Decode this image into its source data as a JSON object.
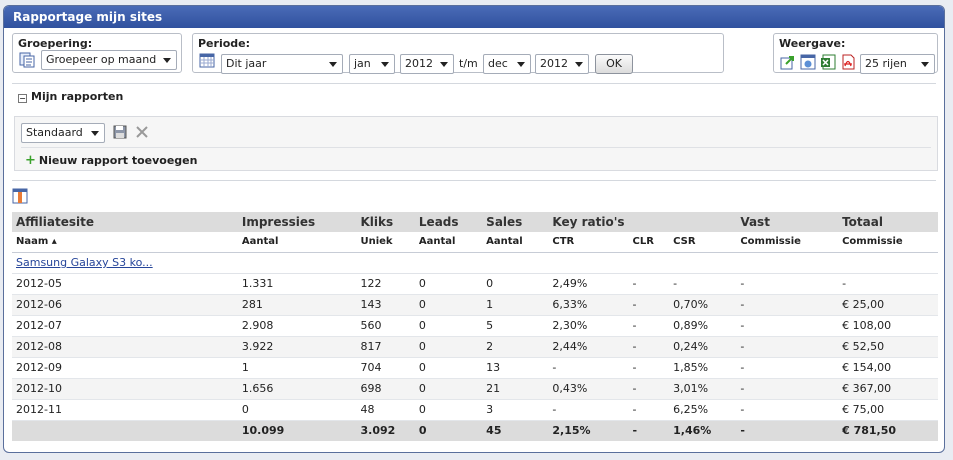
{
  "header": {
    "title": "Rapportage mijn sites"
  },
  "grouping": {
    "label": "Groepering:",
    "value": "Groepeer op maand"
  },
  "period": {
    "label": "Periode:",
    "range": "Dit jaar",
    "from_month": "jan",
    "from_year": "2012",
    "separator": "t/m",
    "to_month": "dec",
    "to_year": "2012",
    "ok_label": "OK"
  },
  "view": {
    "label": "Weergave:",
    "rows": "25 rijen"
  },
  "reports": {
    "toggle": "⊟",
    "title": "Mijn rapporten",
    "selected": "Standaard",
    "add_label": "Nieuw rapport toevoegen"
  },
  "table": {
    "groups": [
      "Affiliatesite",
      "Impressies",
      "Kliks",
      "Leads",
      "Sales",
      "Key ratio's",
      "",
      "",
      "Vast",
      "Totaal"
    ],
    "subheaders": [
      "Naam ▴",
      "Aantal",
      "Uniek",
      "Aantal",
      "Aantal",
      "CTR",
      "CLR",
      "CSR",
      "Commissie",
      "Commissie"
    ],
    "site_link": "Samsung Galaxy S3 ko...",
    "rows": [
      [
        "2012-05",
        "1.331",
        "122",
        "0",
        "0",
        "2,49%",
        "-",
        "-",
        "-",
        "-"
      ],
      [
        "2012-06",
        "281",
        "143",
        "0",
        "1",
        "6,33%",
        "-",
        "0,70%",
        "-",
        "€ 25,00"
      ],
      [
        "2012-07",
        "2.908",
        "560",
        "0",
        "5",
        "2,30%",
        "-",
        "0,89%",
        "-",
        "€ 108,00"
      ],
      [
        "2012-08",
        "3.922",
        "817",
        "0",
        "2",
        "2,44%",
        "-",
        "0,24%",
        "-",
        "€ 52,50"
      ],
      [
        "2012-09",
        "1",
        "704",
        "0",
        "13",
        "-",
        "-",
        "1,85%",
        "-",
        "€ 154,00"
      ],
      [
        "2012-10",
        "1.656",
        "698",
        "0",
        "21",
        "0,43%",
        "-",
        "3,01%",
        "-",
        "€ 367,00"
      ],
      [
        "2012-11",
        "0",
        "48",
        "0",
        "3",
        "-",
        "-",
        "6,25%",
        "-",
        "€ 75,00"
      ]
    ],
    "totals": [
      "",
      "10.099",
      "3.092",
      "0",
      "45",
      "2,15%",
      "-",
      "1,46%",
      "-",
      "€ 781,50"
    ]
  },
  "colors": {
    "header": "#30519e",
    "link": "#26459a",
    "accent_green": "#3aa12b"
  }
}
